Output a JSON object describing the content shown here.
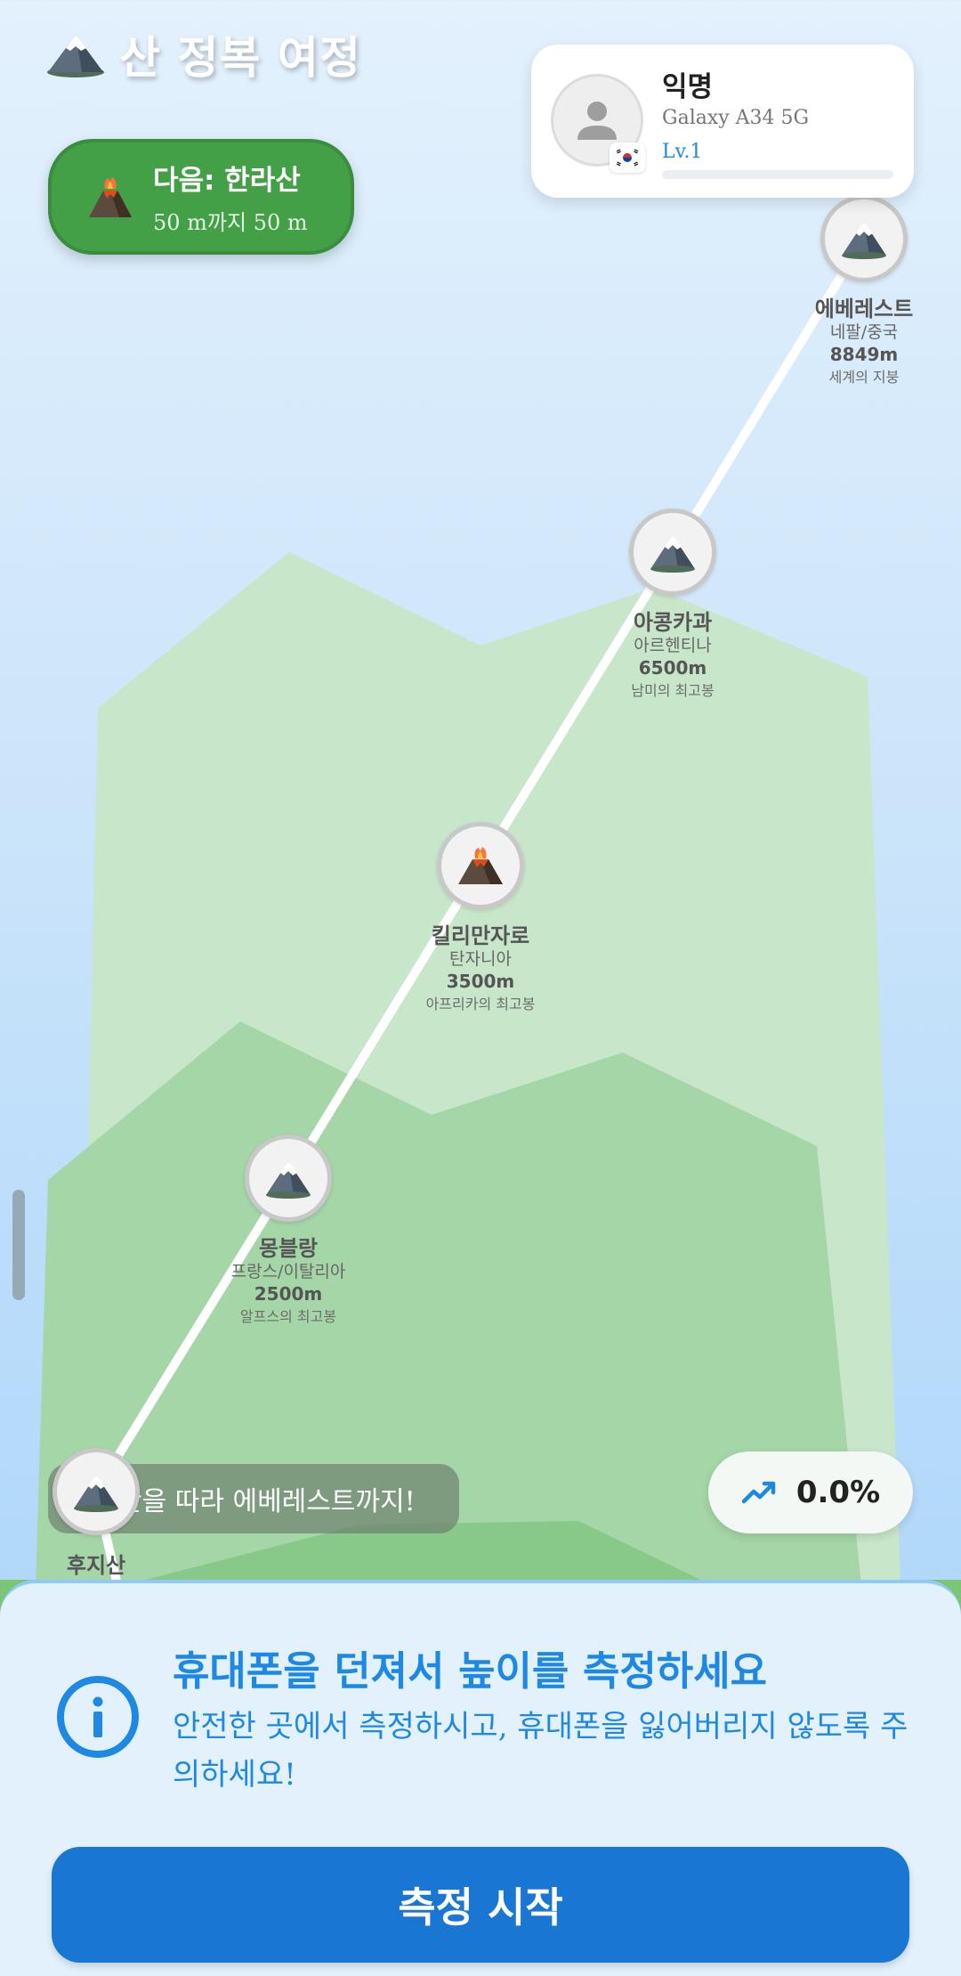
{
  "header": {
    "title": "산 정복 여정",
    "icon": "snow-mountain-icon"
  },
  "next_target": {
    "title": "다음: 한라산",
    "subtitle": "50 m까지 50 m",
    "icon": "volcano-icon"
  },
  "profile": {
    "name": "익명",
    "device": "Galaxy A34 5G",
    "level": "Lv.1",
    "level_progress": 0,
    "flag_icon": "south-korea-flag-icon",
    "avatar_icon": "person-icon"
  },
  "peaks": [
    {
      "id": "everest",
      "name": "에베레스트",
      "country": "네팔/중국",
      "altitude": "8849m",
      "description": "세계의 지붕",
      "icon": "snow-mountain-icon"
    },
    {
      "id": "aconcagua",
      "name": "아콩카과",
      "country": "아르헨티나",
      "altitude": "6500m",
      "description": "남미의 최고봉",
      "icon": "snow-mountain-icon"
    },
    {
      "id": "kilimanjaro",
      "name": "킬리만자로",
      "country": "탄자니아",
      "altitude": "3500m",
      "description": "아프리카의 최고봉",
      "icon": "volcano-icon"
    },
    {
      "id": "montblanc",
      "name": "몽블랑",
      "country": "프랑스/이탈리아",
      "altitude": "2500m",
      "description": "알프스의 최고봉",
      "icon": "snow-mountain-icon"
    },
    {
      "id": "fuji",
      "name": "후지산",
      "icon": "snow-mountain-icon"
    }
  ],
  "toast": {
    "text": "산을 따라 에베레스트까지!"
  },
  "progress": {
    "value": "0.0%",
    "icon": "trending-up-icon"
  },
  "sheet": {
    "title": "휴대폰을 던져서 높이를 측정하세요",
    "description": "안전한 곳에서 측정하시고, 휴대폰을 잃어버리지 않도록 주의하세요!",
    "button_label": "측정 시작",
    "icon": "info-icon"
  },
  "colors": {
    "primary_blue": "#1976d2",
    "accent_blue": "#1e88e5",
    "next_green": "#43a047",
    "mountain_light": "#c8e6c9",
    "mountain_mid": "#a5d6a7"
  }
}
